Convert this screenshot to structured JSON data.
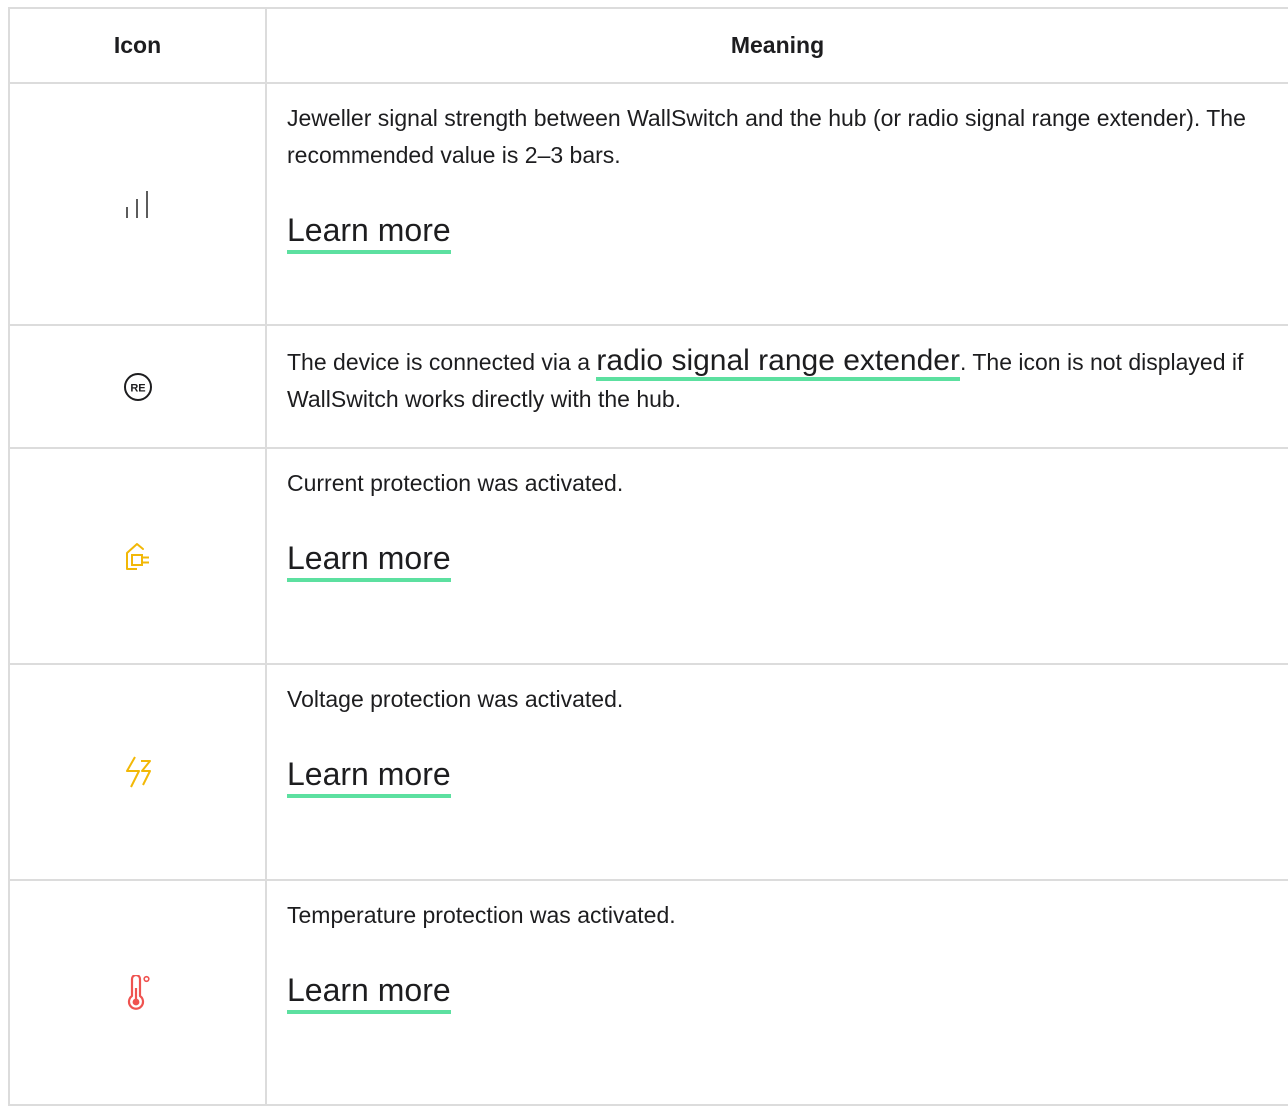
{
  "table": {
    "headers": {
      "icon": "Icon",
      "meaning": "Meaning"
    },
    "rows": [
      {
        "icon": "signal-strength-icon",
        "text": "Jeweller signal strength between WallSwitch and the hub (or radio signal range extender). The recommended value is 2–3 bars.",
        "link": "Learn more"
      },
      {
        "icon": "range-extender-icon",
        "text_before": "The device is connected via a ",
        "link": "radio signal range extender",
        "text_after": ". The icon is not displayed if WallSwitch works directly with the hub.",
        "icon_label": "RE"
      },
      {
        "icon": "current-protection-icon",
        "text": "Current protection was activated.",
        "link": "Learn more"
      },
      {
        "icon": "voltage-protection-icon",
        "text": "Voltage protection was activated.",
        "link": "Learn more"
      },
      {
        "icon": "temperature-protection-icon",
        "text": "Temperature protection was activated.",
        "link": "Learn more"
      }
    ]
  },
  "colors": {
    "link_underline": "#5ce0a0",
    "warning_icon": "#f2b807",
    "temperature_icon": "#ef5350",
    "border": "#dcdcdc"
  }
}
